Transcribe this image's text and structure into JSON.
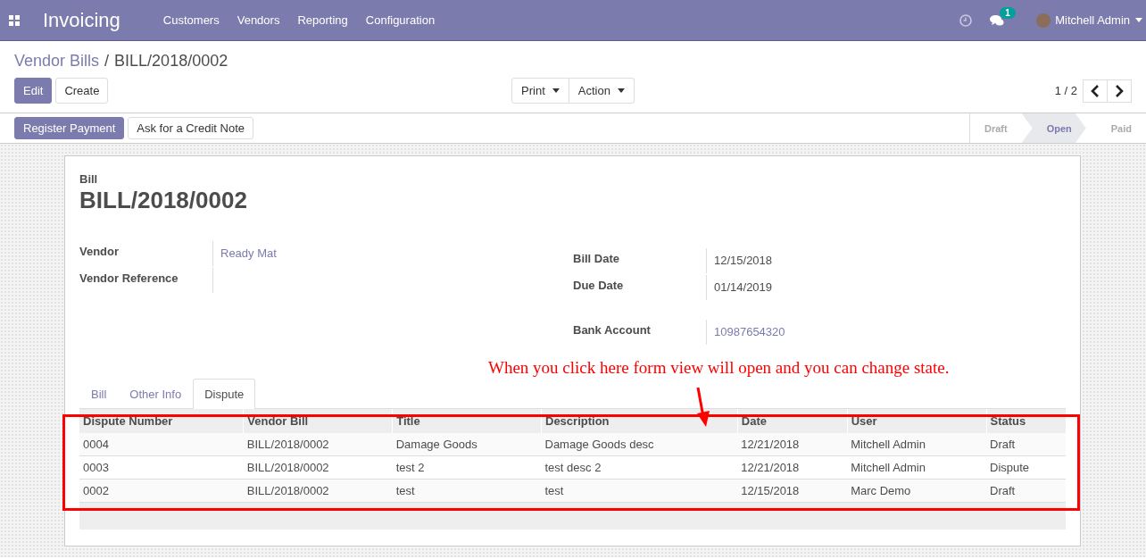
{
  "navbar": {
    "app_name": "Invoicing",
    "menu": [
      "Customers",
      "Vendors",
      "Reporting",
      "Configuration"
    ],
    "messages_badge": "1",
    "user": "Mitchell Admin"
  },
  "breadcrumb": {
    "parent": "Vendor Bills",
    "separator": "/",
    "current": "BILL/2018/0002"
  },
  "buttons": {
    "primary": "Edit",
    "secondary": "Create"
  },
  "dropdowns": [
    "Print",
    "Action"
  ],
  "pager": {
    "text": "1 / 2"
  },
  "header_buttons": [
    {
      "label": "Register Payment",
      "kind": "primary"
    },
    {
      "label": "Ask for a Credit Note",
      "kind": "secondary"
    }
  ],
  "stages": [
    {
      "label": "Draft",
      "selected": false
    },
    {
      "label": "Open",
      "selected": true
    },
    {
      "label": "Paid",
      "selected": false
    }
  ],
  "sheet": {
    "subtitle": "Bill",
    "title": "BILL/2018/0002",
    "left_fields": [
      {
        "label": "Vendor",
        "value": "Ready Mat",
        "kind": "link"
      },
      {
        "label": "Vendor Reference",
        "kind": "empty"
      }
    ],
    "right_fields": [
      {
        "label": "Bill Date",
        "value": "12/15/2018",
        "kind": "text"
      },
      {
        "label": "Due Date",
        "value": "01/14/2019",
        "kind": "text"
      },
      {
        "label": "Bank Account",
        "value": "10987654320",
        "kind": "link"
      }
    ],
    "tabs": [
      {
        "label": "Bill",
        "selected": false
      },
      {
        "label": "Other Info",
        "selected": false
      },
      {
        "label": "Dispute",
        "selected": true
      }
    ],
    "table": {
      "columns": [
        "Dispute Number",
        "Vendor Bill",
        "Title",
        "Description",
        "Date",
        "User",
        "Status"
      ],
      "rows": [
        [
          "0004",
          "BILL/2018/0002",
          "Damage Goods",
          "Damage Goods desc",
          "12/21/2018",
          "Mitchell Admin",
          "Draft"
        ],
        [
          "0003",
          "BILL/2018/0002",
          "test 2",
          "test desc 2",
          "12/21/2018",
          "Mitchell Admin",
          "Dispute"
        ],
        [
          "0002",
          "BILL/2018/0002",
          "test",
          "test",
          "12/15/2018",
          "Marc Demo",
          "Draft"
        ]
      ]
    }
  },
  "annotation": {
    "text": "When you click here form view will open and you can change state."
  }
}
